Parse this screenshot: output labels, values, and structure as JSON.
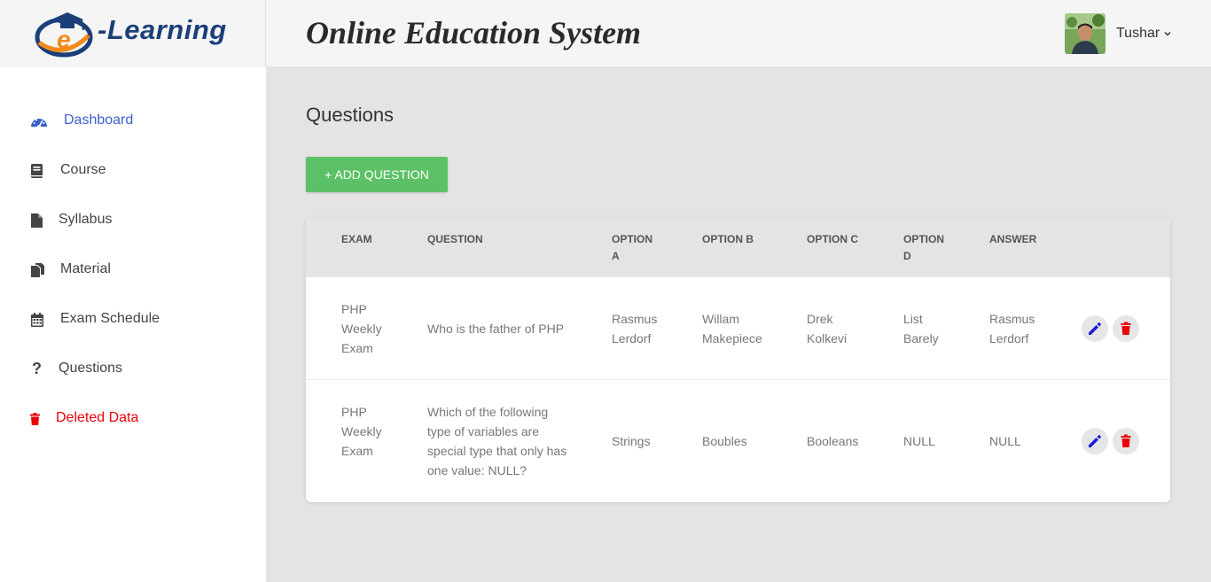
{
  "brand": {
    "logo_text": "-Learning",
    "logo_letter": "e",
    "app_title": "Online Education System"
  },
  "user": {
    "name": "Tushar"
  },
  "sidebar": {
    "items": [
      {
        "label": "Dashboard",
        "icon": "dashboard-icon"
      },
      {
        "label": "Course",
        "icon": "book-icon"
      },
      {
        "label": "Syllabus",
        "icon": "file-icon"
      },
      {
        "label": "Material",
        "icon": "copy-icon"
      },
      {
        "label": "Exam Schedule",
        "icon": "calendar-icon"
      },
      {
        "label": "Questions",
        "icon": "question-icon"
      },
      {
        "label": "Deleted Data",
        "icon": "trash-icon"
      }
    ]
  },
  "main": {
    "title": "Questions",
    "add_button": "+ ADD QUESTION",
    "table": {
      "headers": {
        "exam": "EXAM",
        "question": "QUESTION",
        "option_a_1": "OPTION",
        "option_a_2": "A",
        "option_b": "OPTION B",
        "option_c": "OPTION C",
        "option_d_1": "OPTION",
        "option_d_2": "D",
        "answer": "ANSWER"
      },
      "rows": [
        {
          "exam": [
            "PHP",
            "Weekly",
            "Exam"
          ],
          "question": [
            "Who is the father of PHP"
          ],
          "option_a": [
            "Rasmus",
            "Lerdorf"
          ],
          "option_b": [
            "Willam",
            "Makepiece"
          ],
          "option_c": [
            "Drek",
            "Kolkevi"
          ],
          "option_d": [
            "List",
            "Barely"
          ],
          "answer": [
            "Rasmus",
            "Lerdorf"
          ]
        },
        {
          "exam": [
            "PHP",
            "Weekly",
            "Exam"
          ],
          "question": [
            "Which of the following",
            "type of variables are",
            "special type that only has",
            "one value: NULL?"
          ],
          "option_a": [
            "Strings"
          ],
          "option_b": [
            "Boubles"
          ],
          "option_c": [
            "Booleans"
          ],
          "option_d": [
            "NULL"
          ],
          "answer": [
            "NULL"
          ]
        }
      ]
    }
  },
  "colors": {
    "accent_blue": "#3a5fcd",
    "danger_red": "#e8000b",
    "add_green": "#5cc166",
    "edit_blue": "#1a1adb"
  }
}
